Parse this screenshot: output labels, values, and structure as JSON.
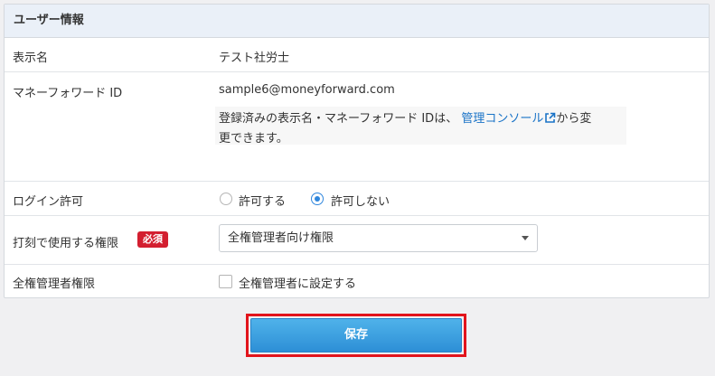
{
  "section_title": "ユーザー情報",
  "rows": {
    "display_name": {
      "label": "表示名",
      "value": "テスト社労士"
    },
    "mf_id": {
      "label": "マネーフォワード ID",
      "value": "sample6@moneyforward.com",
      "note_before": "登録済みの表示名・マネーフォワード IDは、",
      "note_link": "管理コンソール",
      "note_after_line1": "から変",
      "note_line2": "更できます。"
    },
    "login": {
      "label": "ログイン許可",
      "options": [
        "許可する",
        "許可しない"
      ],
      "selected": "許可しない"
    },
    "stamp": {
      "label": "打刻で使用する権限",
      "required_badge": "必須",
      "selected_value": "全権管理者向け権限"
    },
    "admin": {
      "label": "全権管理者権限",
      "checkbox_label": "全権管理者に設定する",
      "checked": false
    }
  },
  "save_label": "保存",
  "colors": {
    "link": "#1a73c7",
    "radio_checked": "#2f86dd",
    "badge": "#d31f30",
    "highlight_border": "#e2141c"
  }
}
